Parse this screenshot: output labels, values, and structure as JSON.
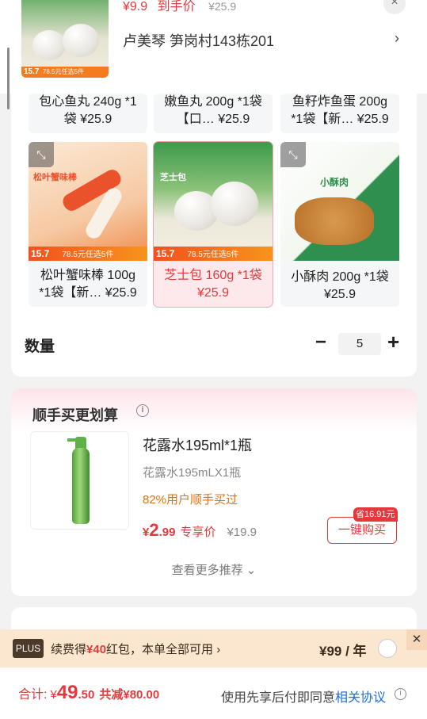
{
  "top": {
    "thumb_strip_price": "15.7",
    "thumb_strip_text": "78.5元任选5件",
    "price_symbol": "¥",
    "price": "9.9",
    "price_tag": "到手价",
    "original_price": "¥25.9",
    "close_icon": "×",
    "address": "卢美琴  笋岗村143栋201",
    "address_arrow": "›"
  },
  "options": [
    {
      "name": "包心鱼丸 240g *1袋 ¥25.9"
    },
    {
      "name": "嫩鱼丸 200g *1袋【口… ¥25.9"
    },
    {
      "name": "鱼籽炸鱼蛋 200g *1袋【新… ¥25.9"
    },
    {
      "name": "松叶蟹味棒 100g *1袋【新… ¥25.9",
      "strip_price": "15.7",
      "strip_text": "78.5元任选5件",
      "img_label": "松叶蟹味棒"
    },
    {
      "name": "芝士包 160g *1袋 ¥25.9",
      "strip_price": "15.7",
      "strip_text": "78.5元任选5件",
      "img_label": "芝士包",
      "selected": true
    },
    {
      "name": "小酥肉 200g *1袋 ¥25.9",
      "img_label": "小酥肉"
    }
  ],
  "zoom_icon": "⤡",
  "quantity": {
    "label": "数量",
    "minus": "−",
    "value": "5",
    "plus": "+"
  },
  "addon": {
    "title": "顺手买更划算",
    "info_icon": "i",
    "product_name": "花露水195ml*1瓶",
    "product_spec": "花露水195mLX1瓶",
    "buy_rate": "82%用户顺手买过",
    "price_symbol": "¥",
    "price_int": "2",
    "price_dec": ".99",
    "price_tag": "专享价",
    "original_price": "¥19.9",
    "save_badge": "省16.91元",
    "buy_button": "一键购买",
    "more": "查看更多推荐 ⌄"
  },
  "plus_bar": {
    "badge": "PLUS",
    "text_prefix": "续费得",
    "text_highlight": "¥40",
    "text_suffix": "红包，本单全部可用 ›",
    "price": "¥99 / 年",
    "close": "✕"
  },
  "bottom": {
    "total_label": "合计:",
    "total_symbol": "¥",
    "total_int": "49",
    "total_dec": ".50",
    "discount": "共减¥80.00",
    "agree_text": "使用先享后付即同意",
    "agree_link": "相关协议",
    "info_icon": "i"
  },
  "colors": {
    "accent": "#e4393c",
    "orange": "#f47b20",
    "plus_bg": "#fbe6cf",
    "link": "#1f6cd6"
  }
}
